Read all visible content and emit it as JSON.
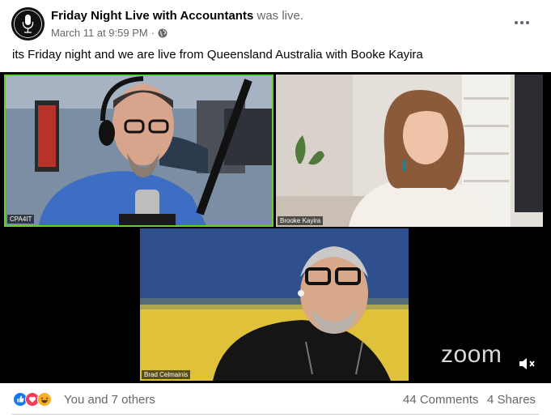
{
  "post": {
    "page_name": "Friday Night Live with Accountants",
    "status_suffix": "was live.",
    "timestamp": "March 11 at 9:59 PM",
    "separator": "·",
    "privacy_icon": "globe-icon",
    "caption": "its Friday night and we are live from Queensland Australia with Booke Kayira"
  },
  "video": {
    "participants": [
      {
        "name": "CPA4IT",
        "active_speaker": true
      },
      {
        "name": "Brooke Kayira",
        "active_speaker": false
      },
      {
        "name": "Brad Celmainis",
        "active_speaker": false
      }
    ],
    "watermark": "zoom",
    "active_border_color": "#5bd42b"
  },
  "footer": {
    "reaction_icons": [
      "like-icon",
      "love-icon",
      "haha-icon"
    ],
    "reaction_text": "You and 7 others",
    "comments": "44 Comments",
    "shares": "4 Shares"
  },
  "colors": {
    "like": "#1877f2",
    "love": "#f33e58",
    "haha": "#f7b125",
    "secondary_text": "#65676b"
  }
}
